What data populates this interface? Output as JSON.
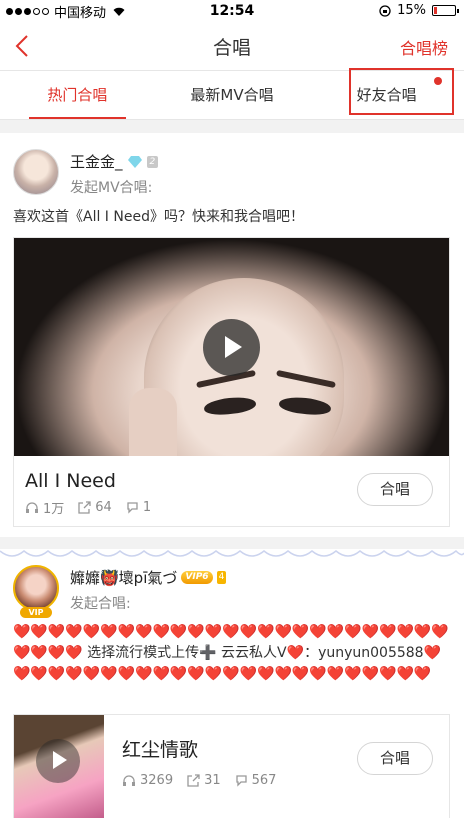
{
  "status_bar": {
    "carrier": "中国移动",
    "time": "12:54",
    "battery": "15%",
    "battery_level": 0.15
  },
  "nav": {
    "title": "合唱",
    "right_link": "合唱榜"
  },
  "tabs": [
    {
      "label": "热门合唱",
      "active": true
    },
    {
      "label": "最新MV合唱",
      "active": false
    },
    {
      "label": "好友合唱",
      "active": false,
      "has_dot": true
    }
  ],
  "posts": [
    {
      "user": "王金金_",
      "level": "2",
      "action": "发起MV合唱:",
      "description": "喜欢这首《All I Need》吗？快来和我合唱吧！",
      "song": "All I Need",
      "stats": {
        "listens": "1万",
        "shares": "64",
        "comments": "1"
      },
      "button": "合唱"
    },
    {
      "user": "孊孊👹壞pī氣づ",
      "vip": "VIP6",
      "vip_tag": "VIP",
      "crown_level": "4",
      "action": "发起合唱:",
      "description": "❤️❤️❤️❤️❤️❤️❤️❤️❤️❤️❤️❤️❤️❤️❤️❤️❤️❤️❤️❤️❤️❤️❤️❤️❤️❤️❤️❤️❤️ 选择流行模式上传➕ 云云私人V❤️：yunyun005588❤️❤️❤️❤️❤️❤️❤️❤️❤️❤️❤️❤️❤️❤️❤️❤️❤️❤️❤️❤️❤️❤️❤️❤️❤️",
      "song": "红尘情歌",
      "stats": {
        "listens": "3269",
        "shares": "31",
        "comments": "567"
      },
      "button": "合唱"
    }
  ],
  "colors": {
    "accent": "#e0332b",
    "muted": "#888888",
    "background": "#f2f2f2"
  }
}
